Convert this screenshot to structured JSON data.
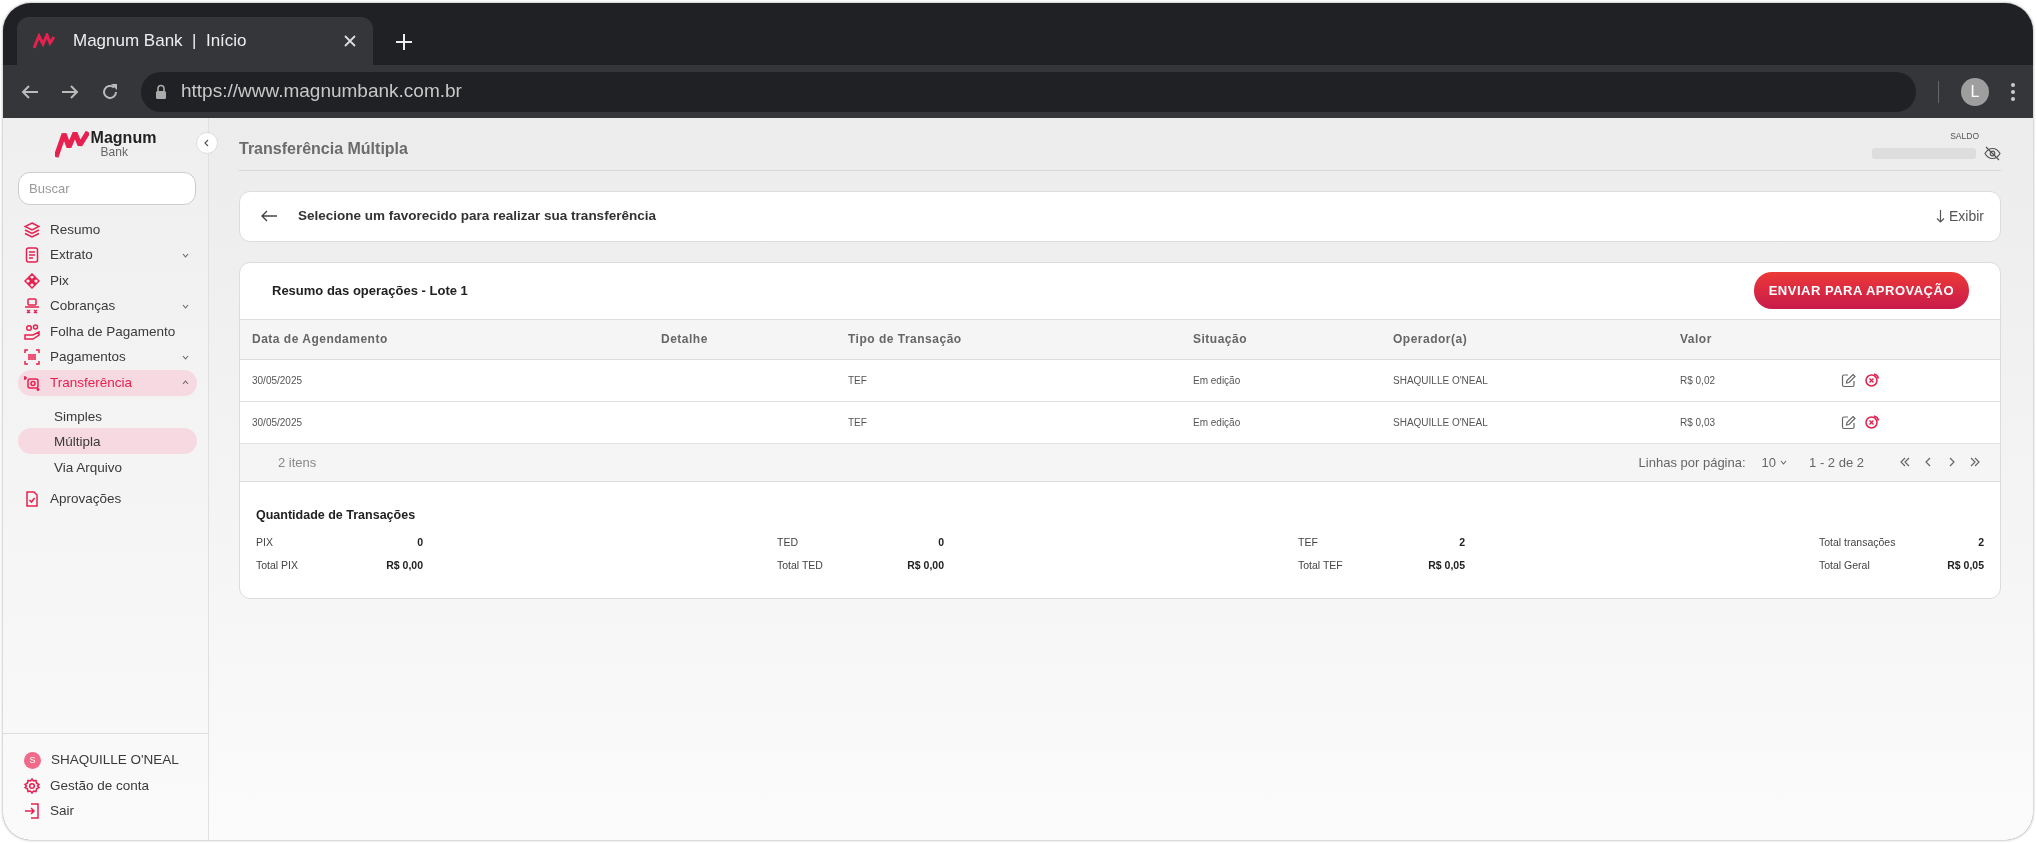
{
  "browser": {
    "tab_title": "Magnum Bank  |  Início",
    "url": "https://www.magnumbank.com.br",
    "profile_initial": "L"
  },
  "sidebar": {
    "logo": {
      "name": "Magnum",
      "sub": "Bank"
    },
    "search": {
      "placeholder": "Buscar"
    },
    "items": [
      {
        "label": "Resumo",
        "selected": false
      },
      {
        "label": "Extrato",
        "expanded": false,
        "selected": false
      },
      {
        "label": "Pix",
        "selected": false
      },
      {
        "label": "Cobranças",
        "expanded": false,
        "selected": false
      },
      {
        "label": "Folha de Pagamento",
        "selected": false
      },
      {
        "label": "Pagamentos",
        "expanded": false,
        "selected": false
      },
      {
        "label": "Transferência",
        "expanded": true,
        "selected": true,
        "children": [
          {
            "label": "Simples",
            "selected": false
          },
          {
            "label": "Múltipla",
            "selected": true
          },
          {
            "label": "Via Arquivo",
            "selected": false
          }
        ]
      },
      {
        "label": "Aprovações",
        "selected": false
      }
    ],
    "footer": [
      {
        "kind": "user",
        "label": "SHAQUILLE O'NEAL",
        "initial": "S"
      },
      {
        "kind": "settings",
        "label": "Gestão de conta"
      },
      {
        "kind": "logout",
        "label": "Sair"
      }
    ]
  },
  "header": {
    "title": "Transferência Múltipla",
    "balance_label": "SALDO"
  },
  "selector": {
    "text": "Selecione um favorecido para realizar sua transferência",
    "action": "Exibir"
  },
  "batch": {
    "title": "Resumo das operações - Lote 1",
    "submit_button": "ENVIAR PARA APROVAÇÃO",
    "columns": [
      "Data de Agendamento",
      "Detalhe",
      "Tipo de Transação",
      "Situação",
      "Operador(a)",
      "Valor"
    ],
    "rows": [
      {
        "date": "30/05/2025",
        "type": "TEF",
        "status": "Em edição",
        "operator": "SHAQUILLE O'NEAL",
        "value": "R$ 0,02"
      },
      {
        "date": "30/05/2025",
        "type": "TEF",
        "status": "Em edição",
        "operator": "SHAQUILLE O'NEAL",
        "value": "R$ 0,03"
      }
    ],
    "footer": {
      "count": "2 itens",
      "rows_per_page_label": "Linhas por página:",
      "rows_per_page": "10",
      "range": "1 - 2 de 2"
    },
    "summary": {
      "title": "Quantidade de Transações",
      "groups": [
        {
          "label": "PIX",
          "count": "0",
          "total_label": "Total PIX",
          "total": "R$ 0,00"
        },
        {
          "label": "TED",
          "count": "0",
          "total_label": "Total TED",
          "total": "R$ 0,00"
        },
        {
          "label": "TEF",
          "count": "2",
          "total_label": "Total TEF",
          "total": "R$ 0,05"
        },
        {
          "label": "Total transações",
          "count": "2",
          "total_label": "Total Geral",
          "total": "R$ 0,05"
        }
      ]
    }
  }
}
